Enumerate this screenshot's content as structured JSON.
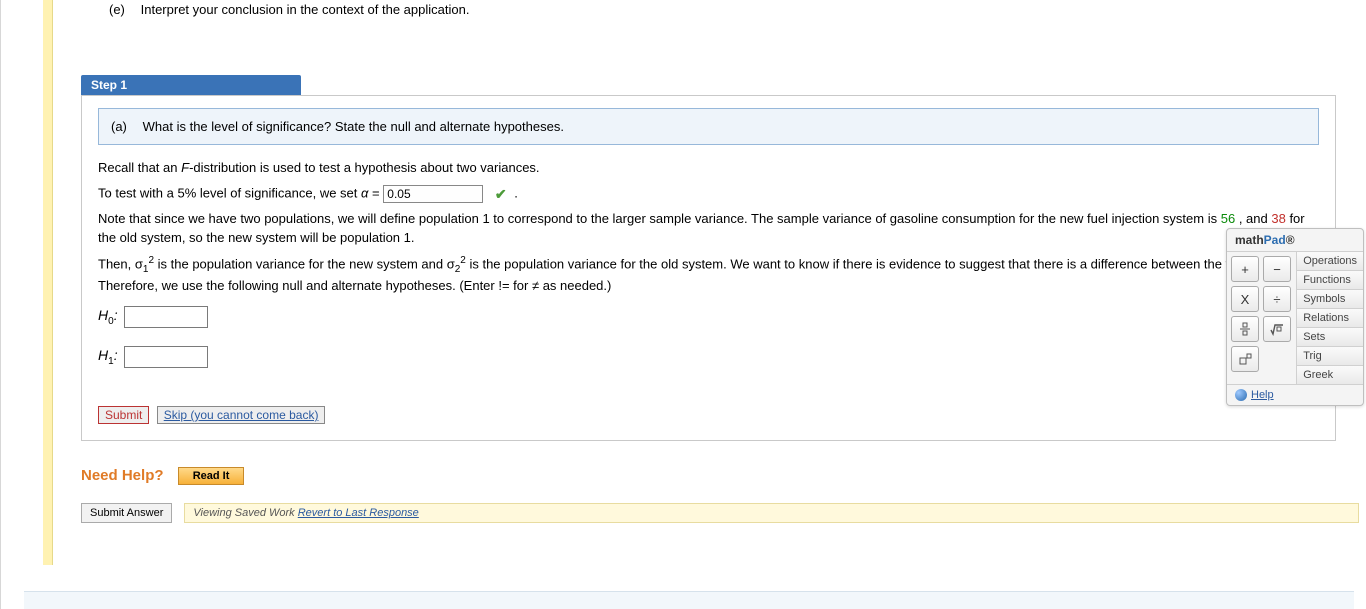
{
  "part_e": {
    "label": "(e)",
    "text": "Interpret your conclusion in the context of the application."
  },
  "step": {
    "title": "Step 1"
  },
  "sub_q": {
    "label": "(a)",
    "text": "What is the level of significance? State the null and alternate hypotheses."
  },
  "recall": "Recall that an F-distribution is used to test a hypothesis about two variances.",
  "test_prefix": "To test with a 5% level of significance, we set α = ",
  "alpha_val": "0.05",
  "period": ".",
  "note_a": "Note that since we have two populations, we will define population 1 to correspond to the larger sample variance. The sample variance of gasoline consumption for the new fuel injection system is ",
  "val56": "56",
  "note_mid": ", and ",
  "val38": "38",
  "note_b": " for the old system, so the new system will be population 1.",
  "then_a": "Then, σ",
  "sub1": "1",
  "sup2": "2",
  "then_b": " is the population variance for the new system and σ",
  "sub2": "2",
  "then_c": " is the population variance for the old system. We want to know if there is evidence to suggest that there is a difference between the variances. Therefore, we use the following null and alternate hypotheses. (Enter != for ≠ as needed.)",
  "H0": "H",
  "H0sub": "0",
  "colon": ":",
  "H1": "H",
  "H1sub": "1",
  "submit": "Submit",
  "skip": "Skip (you cannot come back)",
  "need_help": "Need Help?",
  "read_it": "Read It",
  "submit_answer": "Submit Answer",
  "saved_prefix": "Viewing Saved Work ",
  "revert": "Revert to Last Response",
  "mathpad": {
    "title_a": "math",
    "title_b": "Pad",
    "title_c": "®",
    "cats": [
      "Operations",
      "Functions",
      "Symbols",
      "Relations",
      "Sets",
      "Trig",
      "Greek"
    ],
    "help": "Help",
    "keys": {
      "plus": "+",
      "minus": "−",
      "times": "X",
      "divide": "÷"
    }
  }
}
